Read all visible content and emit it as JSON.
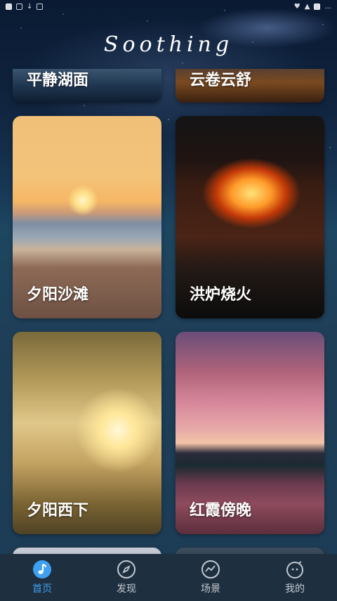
{
  "status_bar": {
    "left_icons": [
      "app-icon",
      "sim-icon",
      "download-icon",
      "photo-icon"
    ],
    "right_icons": [
      "heart-icon",
      "signal-icon",
      "battery-icon"
    ],
    "time": "..."
  },
  "app_title": "Soothing",
  "scenes": [
    {
      "label": "平静湖面",
      "id": "lake"
    },
    {
      "label": "云卷云舒",
      "id": "cloud"
    },
    {
      "label": "夕阳沙滩",
      "id": "beach"
    },
    {
      "label": "洪炉烧火",
      "id": "fire"
    },
    {
      "label": "夕阳西下",
      "id": "sunset"
    },
    {
      "label": "红霞傍晚",
      "id": "glow"
    }
  ],
  "tab_bar": {
    "items": [
      {
        "label": "首页",
        "icon": "music-note-icon",
        "active": true
      },
      {
        "label": "发现",
        "icon": "compass-icon",
        "active": false
      },
      {
        "label": "场景",
        "icon": "chart-icon",
        "active": false
      },
      {
        "label": "我的",
        "icon": "face-icon",
        "active": false
      }
    ]
  },
  "colors": {
    "accent": "#3fa0f2",
    "tab_bg": "#1e2f3f",
    "tab_inactive": "#c3c9d0"
  }
}
